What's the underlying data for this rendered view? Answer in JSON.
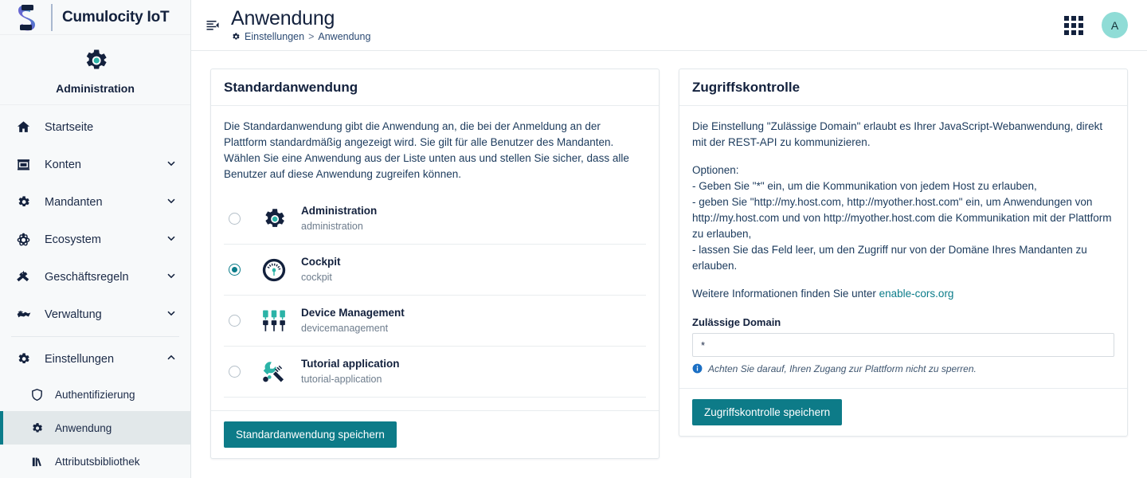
{
  "brand": {
    "name": "Cumulocity IoT",
    "logo_icon": "software-ag-s-logo"
  },
  "sidebar": {
    "app_context": {
      "label": "Administration",
      "icon": "gear-icon"
    },
    "items": [
      {
        "label": "Startseite",
        "icon": "home-icon",
        "caret": false
      },
      {
        "label": "Konten",
        "icon": "accounts-icon",
        "caret": true
      },
      {
        "label": "Mandanten",
        "icon": "gear-icon",
        "caret": true
      },
      {
        "label": "Ecosystem",
        "icon": "ecosystem-atom-icon",
        "caret": true
      },
      {
        "label": "Geschäftsregeln",
        "icon": "business-rules-icon",
        "caret": true
      },
      {
        "label": "Verwaltung",
        "icon": "handshake-icon",
        "caret": true
      }
    ],
    "settings": {
      "label": "Einstellungen",
      "icon": "gear-icon",
      "expanded": true
    },
    "sub_items": [
      {
        "label": "Authentifizierung",
        "icon": "shield-icon",
        "active": false
      },
      {
        "label": "Anwendung",
        "icon": "gear-icon",
        "active": true
      },
      {
        "label": "Attributsbibliothek",
        "icon": "library-icon",
        "active": false
      }
    ]
  },
  "header": {
    "collapse_icon": "collapse-menu-icon",
    "title": "Anwendung",
    "breadcrumb": {
      "icon": "gear-icon",
      "parent": "Einstellungen",
      "separator": ">",
      "current": "Anwendung"
    },
    "apps_switcher_icon": "grid-apps-icon",
    "avatar_initial": "A"
  },
  "default_application": {
    "card_title": "Standardanwendung",
    "description": "Die Standardanwendung gibt die Anwendung an, die bei der Anmeldung an der Plattform standardmäßig angezeigt wird. Sie gilt für alle Benutzer des Mandanten. Wählen Sie eine Anwendung aus der Liste unten aus und stellen Sie sicher, dass alle Benutzer auf diese Anwendung zugreifen können.",
    "applications": [
      {
        "name": "Administration",
        "context": "administration",
        "icon": "gear-icon",
        "selected": false
      },
      {
        "name": "Cockpit",
        "context": "cockpit",
        "icon": "gauge-icon",
        "selected": true
      },
      {
        "name": "Device Management",
        "context": "devicemanagement",
        "icon": "devices-plugs-icon",
        "selected": false
      },
      {
        "name": "Tutorial application",
        "context": "tutorial-application",
        "icon": "wrench-tools-icon",
        "selected": false
      }
    ],
    "save_label": "Standardanwendung speichern"
  },
  "access_control": {
    "card_title": "Zugriffskontrolle",
    "paragraph1": "Die Einstellung \"Zulässige Domain\" erlaubt es Ihrer JavaScript-Webanwendung, direkt mit der REST-API zu kommunizieren.",
    "options_heading": "Optionen:",
    "option1": "- Geben Sie \"*\" ein, um die Kommunikation von jedem Host zu erlauben,",
    "option2": "- geben Sie \"http://my.host.com, http://myother.host.com\" ein, um Anwendungen von http://my.host.com und von http://myother.host.com die Kommunikation mit der Plattform zu erlauben,",
    "option3": "- lassen Sie das Feld leer, um den Zugriff nur von der Domäne Ihres Mandanten zu erlauben.",
    "more_info_prefix": "Weitere Informationen finden Sie unter ",
    "more_info_link": "enable-cors.org",
    "domain_label": "Zulässige Domain",
    "domain_value": "*",
    "domain_placeholder": "",
    "hint_icon": "info-icon",
    "hint_text": "Achten Sie darauf, Ihren Zugang zur Plattform nicht zu sperren.",
    "save_label": "Zugriffskontrolle speichern"
  },
  "colors": {
    "accent_teal": "#0d7b88",
    "brand_navy": "#13213d",
    "avatar_bg": "#8fdcd6",
    "link": "#0b7c8a",
    "icon_accent": "#2bb3a7",
    "info_blue": "#1a6fc4"
  }
}
